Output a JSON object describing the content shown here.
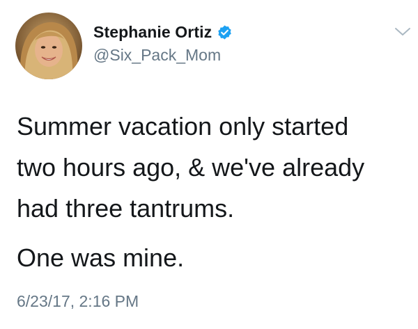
{
  "author": {
    "display_name": "Stephanie Ortiz",
    "handle": "@Six_Pack_Mom",
    "verified": true,
    "avatar_icon": "profile-photo"
  },
  "tweet": {
    "lines": [
      "Summer vacation only started",
      "two hours ago, & we've already",
      "had three tantrums."
    ],
    "second_paragraph": "One was mine.",
    "timestamp": "6/23/17, 2:16 PM"
  },
  "icons": {
    "verified": "verified-badge-icon",
    "menu": "chevron-down-icon"
  },
  "colors": {
    "text": "#14171a",
    "secondary": "#657786",
    "verified_blue": "#1da1f2",
    "background": "#ffffff"
  }
}
